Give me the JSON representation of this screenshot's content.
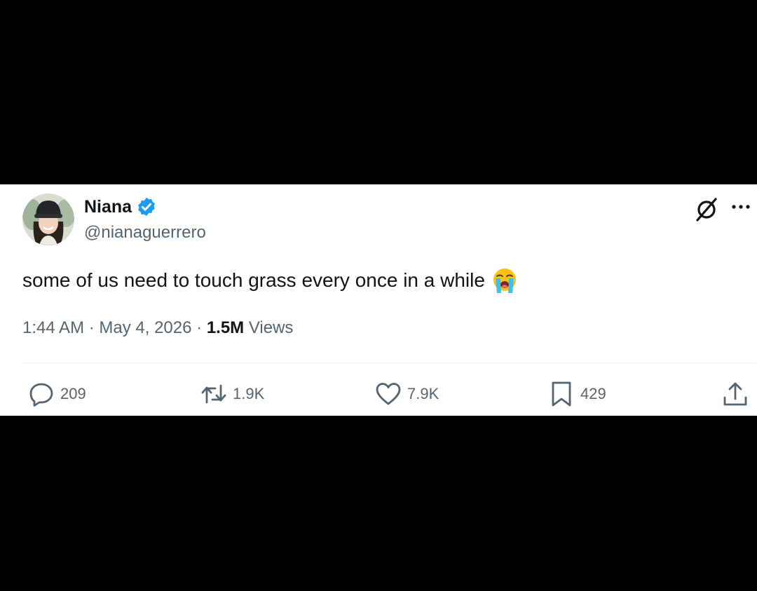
{
  "author": {
    "name": "Niana",
    "handle": "@nianaguerrero"
  },
  "tweet": {
    "text": "some of us need to touch grass every once in a while",
    "emoji": "loudly-crying-face"
  },
  "meta": {
    "time": "1:44 AM",
    "separator": " · ",
    "date": "May 4, 2026",
    "views_count": "1.5M",
    "views_label": " Views"
  },
  "actions": {
    "replies": "209",
    "reposts": "1.9K",
    "likes": "7.9K",
    "bookmarks": "429"
  },
  "icons": {
    "verified": "verified-badge-icon",
    "grok": "grok-icon",
    "more": "more-icon",
    "reply": "reply-icon",
    "repost": "repost-icon",
    "like": "heart-icon",
    "bookmark": "bookmark-icon",
    "share": "share-icon"
  },
  "colors": {
    "verified": "#1d9bf0",
    "text_primary": "#0f1419",
    "text_secondary": "#536471"
  }
}
